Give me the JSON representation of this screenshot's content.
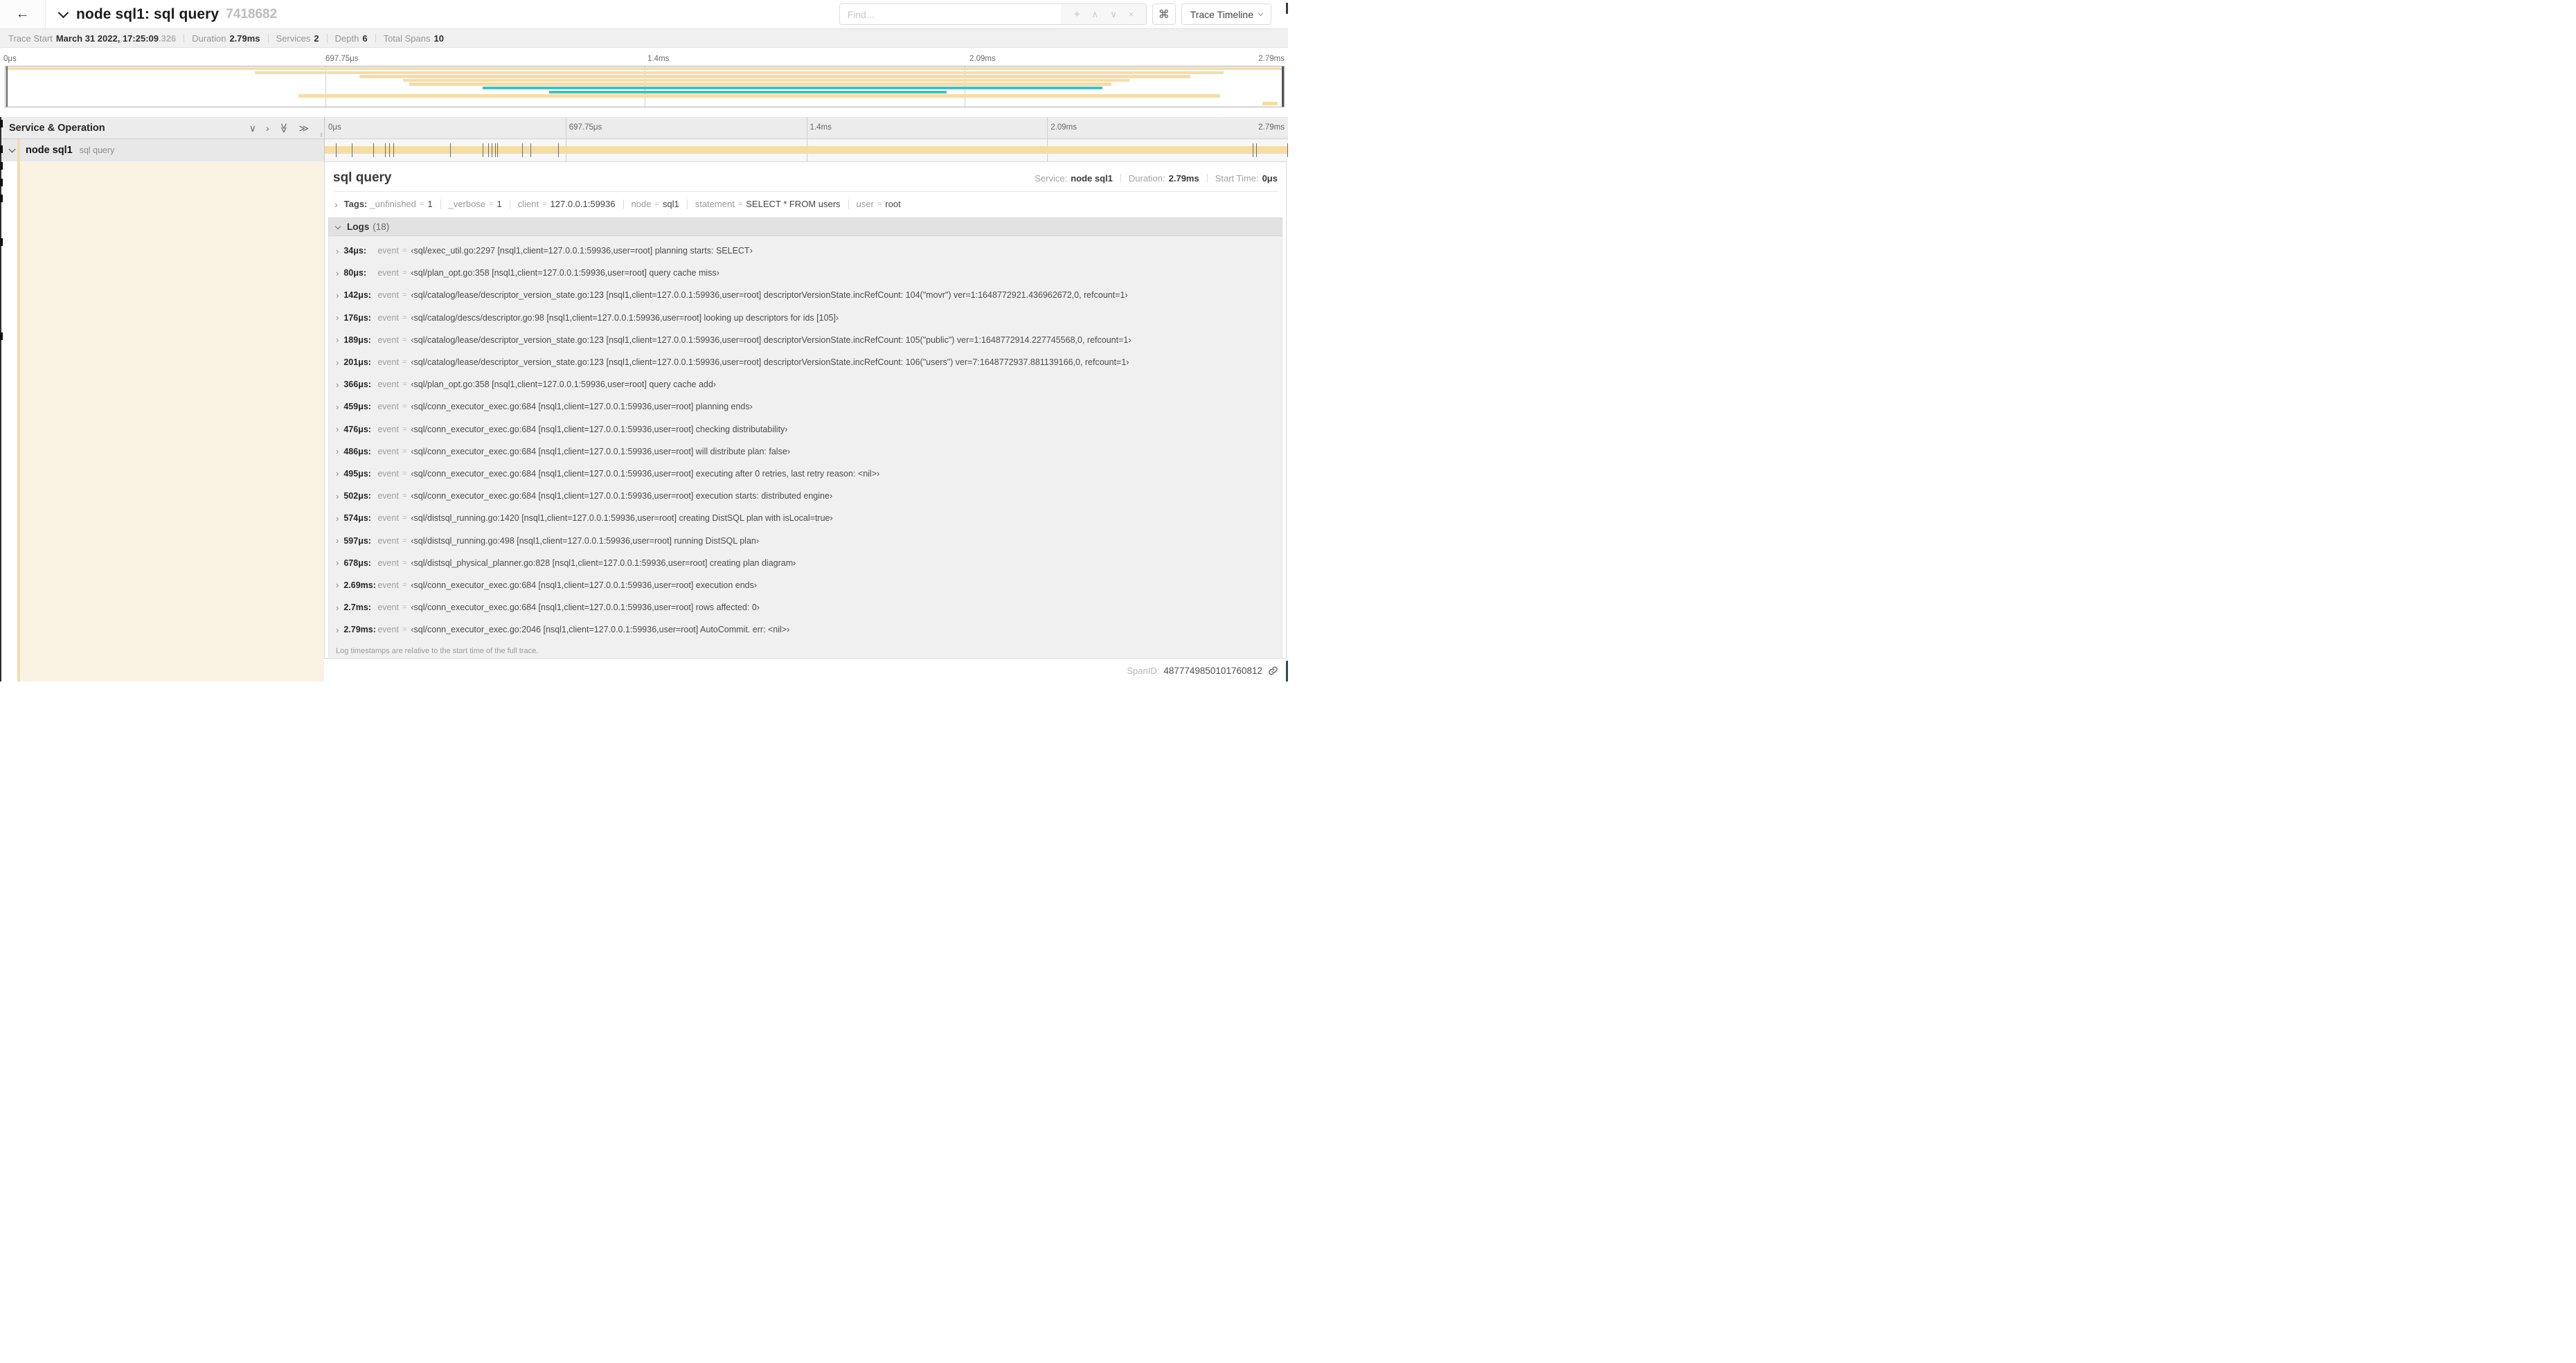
{
  "colors": {
    "span_tan": "#f6dda4",
    "span_teal": "#44c0c0",
    "detail_cream": "#faf3e3"
  },
  "header": {
    "back_icon": "←",
    "title": "node sql1: sql query",
    "trace_id": "7418682",
    "find_placeholder": "Find...",
    "suffix_icons": {
      "target": "⌖",
      "prev": "∧",
      "next": "∨",
      "clear": "×"
    },
    "shortcut_key": "⌘",
    "view_button": "Trace Timeline"
  },
  "summary": {
    "items": [
      {
        "label": "Trace Start",
        "value": "March 31 2022, 17:25:09",
        "suffix": ".326"
      },
      {
        "label": "Duration",
        "value": "2.79ms"
      },
      {
        "label": "Services",
        "value": "2"
      },
      {
        "label": "Depth",
        "value": "6"
      },
      {
        "label": "Total Spans",
        "value": "10"
      }
    ]
  },
  "time_axis": [
    {
      "label": "0μs",
      "pct": 0
    },
    {
      "label": "697.75μs",
      "pct": 25
    },
    {
      "label": "1.4ms",
      "pct": 50
    },
    {
      "label": "2.09ms",
      "pct": 75
    },
    {
      "label": "2.79ms",
      "pct": 100,
      "align": "right"
    }
  ],
  "minimap": {
    "rows": [
      {
        "row": 1,
        "start": 0,
        "end": 100,
        "color": "span_tan"
      },
      {
        "row": 2,
        "start": 19.5,
        "end": 95.3,
        "color": "span_tan"
      },
      {
        "row": 3,
        "start": 27.7,
        "end": 92.7,
        "color": "span_tan"
      },
      {
        "row": 4,
        "start": 31.1,
        "end": 87.9,
        "color": "span_tan"
      },
      {
        "row": 5,
        "start": 31.6,
        "end": 86.5,
        "color": "span_tan"
      },
      {
        "row": 6,
        "start": 37.3,
        "end": 85.8,
        "color": "span_teal"
      },
      {
        "row": 7,
        "start": 42.5,
        "end": 73.6,
        "color": "span_teal"
      },
      {
        "row": 8,
        "start": 22.9,
        "end": 95.0,
        "color": "span_tan"
      },
      {
        "row": 10,
        "start": 98.3,
        "end": 99.5,
        "color": "span_tan"
      }
    ]
  },
  "timeline": {
    "left_header": "Service & Operation",
    "ticks": [
      {
        "label": "0μs",
        "pct": 0
      },
      {
        "label": "697.75μs",
        "pct": 25
      },
      {
        "label": "1.4ms",
        "pct": 50
      },
      {
        "label": "2.09ms",
        "pct": 75
      },
      {
        "label": "2.79ms",
        "pct": 100,
        "align": "right"
      }
    ],
    "span_row": {
      "service": "node sql1",
      "operation": "sql query",
      "bar_start_pct": 0,
      "bar_end_pct": 100,
      "log_marker_pcts": [
        1.22,
        2.87,
        5.09,
        6.31,
        6.77,
        7.2,
        13.12,
        16.45,
        17.06,
        17.42,
        17.74,
        18.0,
        20.57,
        21.4,
        24.3,
        96.42,
        96.77,
        100
      ]
    }
  },
  "detail": {
    "operation": "sql query",
    "meta": [
      {
        "label": "Service:",
        "value": "node sql1"
      },
      {
        "label": "Duration:",
        "value": "2.79ms"
      },
      {
        "label": "Start Time:",
        "value": "0μs"
      }
    ],
    "tags_label": "Tags:",
    "tags": [
      {
        "key": "_unfinished",
        "value": "1"
      },
      {
        "key": "_verbose",
        "value": "1"
      },
      {
        "key": "client",
        "value": "127.0.0.1:59936"
      },
      {
        "key": "node",
        "value": "sql1"
      },
      {
        "key": "statement",
        "value": "SELECT * FROM users"
      },
      {
        "key": "user",
        "value": "root"
      }
    ],
    "logs_label": "Logs",
    "logs_count": "(18)",
    "logs": [
      {
        "time": "34μs:",
        "field": "event",
        "value": "‹sql/exec_util.go:2297 [nsql1,client=127.0.0.1:59936,user=root] planning starts: SELECT›"
      },
      {
        "time": "80μs:",
        "field": "event",
        "value": "‹sql/plan_opt.go:358 [nsql1,client=127.0.0.1:59936,user=root] query cache miss›"
      },
      {
        "time": "142μs:",
        "field": "event",
        "value": "‹sql/catalog/lease/descriptor_version_state.go:123 [nsql1,client=127.0.0.1:59936,user=root] descriptorVersionState.incRefCount: 104(\"movr\") ver=1:1648772921.436962672,0, refcount=1›"
      },
      {
        "time": "176μs:",
        "field": "event",
        "value": "‹sql/catalog/descs/descriptor.go:98 [nsql1,client=127.0.0.1:59936,user=root] looking up descriptors for ids [105]›"
      },
      {
        "time": "189μs:",
        "field": "event",
        "value": "‹sql/catalog/lease/descriptor_version_state.go:123 [nsql1,client=127.0.0.1:59936,user=root] descriptorVersionState.incRefCount: 105(\"public\") ver=1:1648772914.227745568,0, refcount=1›"
      },
      {
        "time": "201μs:",
        "field": "event",
        "value": "‹sql/catalog/lease/descriptor_version_state.go:123 [nsql1,client=127.0.0.1:59936,user=root] descriptorVersionState.incRefCount: 106(\"users\") ver=7:1648772937.881139166,0, refcount=1›"
      },
      {
        "time": "366μs:",
        "field": "event",
        "value": "‹sql/plan_opt.go:358 [nsql1,client=127.0.0.1:59936,user=root] query cache add›"
      },
      {
        "time": "459μs:",
        "field": "event",
        "value": "‹sql/conn_executor_exec.go:684 [nsql1,client=127.0.0.1:59936,user=root] planning ends›"
      },
      {
        "time": "476μs:",
        "field": "event",
        "value": "‹sql/conn_executor_exec.go:684 [nsql1,client=127.0.0.1:59936,user=root] checking distributability›"
      },
      {
        "time": "486μs:",
        "field": "event",
        "value": "‹sql/conn_executor_exec.go:684 [nsql1,client=127.0.0.1:59936,user=root] will distribute plan: false›"
      },
      {
        "time": "495μs:",
        "field": "event",
        "value": "‹sql/conn_executor_exec.go:684 [nsql1,client=127.0.0.1:59936,user=root] executing after 0 retries, last retry reason: <nil>›"
      },
      {
        "time": "502μs:",
        "field": "event",
        "value": "‹sql/conn_executor_exec.go:684 [nsql1,client=127.0.0.1:59936,user=root] execution starts: distributed engine›"
      },
      {
        "time": "574μs:",
        "field": "event",
        "value": "‹sql/distsql_running.go:1420 [nsql1,client=127.0.0.1:59936,user=root] creating DistSQL plan with isLocal=true›"
      },
      {
        "time": "597μs:",
        "field": "event",
        "value": "‹sql/distsql_running.go:498 [nsql1,client=127.0.0.1:59936,user=root] running DistSQL plan›"
      },
      {
        "time": "678μs:",
        "field": "event",
        "value": "‹sql/distsql_physical_planner.go:828 [nsql1,client=127.0.0.1:59936,user=root] creating plan diagram›"
      },
      {
        "time": "2.69ms:",
        "field": "event",
        "value": "‹sql/conn_executor_exec.go:684 [nsql1,client=127.0.0.1:59936,user=root] execution ends›"
      },
      {
        "time": "2.7ms:",
        "field": "event",
        "value": "‹sql/conn_executor_exec.go:684 [nsql1,client=127.0.0.1:59936,user=root] rows affected: 0›"
      },
      {
        "time": "2.79ms:",
        "field": "event",
        "value": "‹sql/conn_executor_exec.go:2046 [nsql1,client=127.0.0.1:59936,user=root] AutoCommit. err: <nil>›"
      }
    ],
    "logs_note": "Log timestamps are relative to the start time of the full trace.",
    "span_id_label": "SpanID:",
    "span_id": "4877749850101760812"
  }
}
